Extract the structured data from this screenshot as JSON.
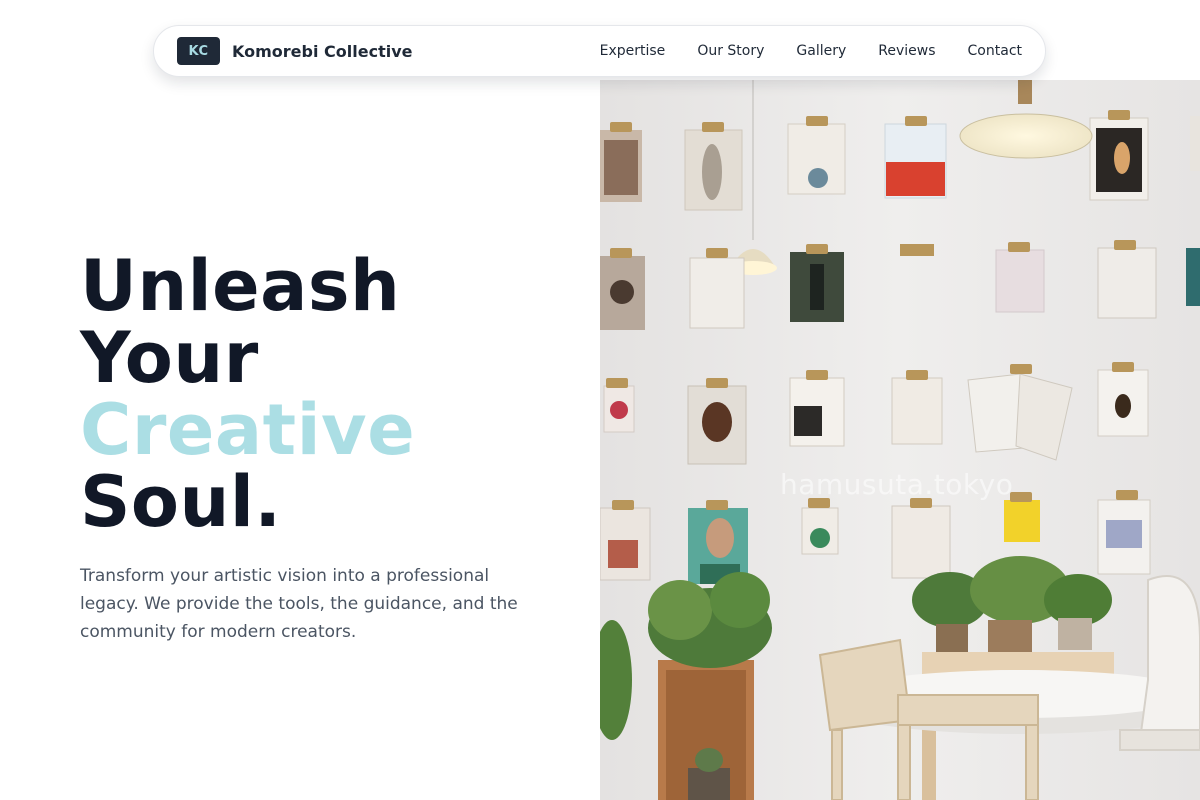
{
  "brand": {
    "logo_text": "KC",
    "name": "Komorebi Collective"
  },
  "nav": {
    "links": [
      "Expertise",
      "Our Story",
      "Gallery",
      "Reviews",
      "Contact"
    ]
  },
  "hero": {
    "title_line1": "Unleash",
    "title_line2": "Your",
    "title_line3": "Creative",
    "title_line4": "Soul.",
    "subtitle": "Transform your artistic vision into a professional legacy. We provide the tools, the guidance, and the community for modern creators."
  },
  "photo": {
    "watermark": "hamusuta.tokyo"
  },
  "colors": {
    "accent": "#abdee4",
    "heading": "#111827",
    "body_text": "#4b5563",
    "logo_bg": "#1f2937"
  }
}
